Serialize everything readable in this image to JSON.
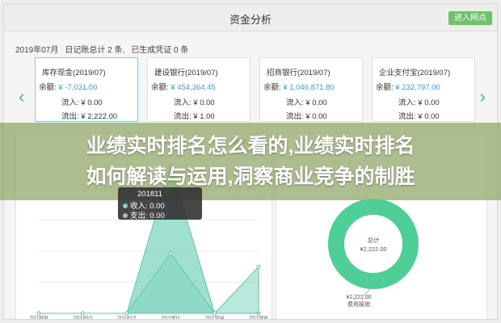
{
  "window": {
    "title": "资金分析",
    "enter_button": "进入网点"
  },
  "summary": {
    "month": "2019年07月",
    "records": "日记账总计 2 条,",
    "generated": "已生成凭证 0 条"
  },
  "accounts": [
    {
      "name": "库存现金(2019/07)",
      "balance_label": "余额: ",
      "balance": "¥ -7,031.00",
      "income": "流入: ¥ 0.00",
      "expense": "流出: ¥ 2,222.00"
    },
    {
      "name": "建设银行(2019/07)",
      "balance_label": "余额: ",
      "balance": "¥ 454,364.45",
      "income": "流入: ¥ 0.00",
      "expense": "流出: ¥ 1.00"
    },
    {
      "name": "招商银行(2019/07)",
      "balance_label": "余额: ",
      "balance": "¥ 1,046,871.80",
      "income": "流入: ¥ 0.00",
      "expense": "流出: ¥ 0.00"
    },
    {
      "name": "企业支付宝(2019/07)",
      "balance_label": "余额: ",
      "balance": "¥ 232,797.00",
      "income": "流入: ¥ 0.00",
      "expense": "流出: ¥ 0.00"
    }
  ],
  "banner": {
    "line1": "业绩实时排名怎么看的,业绩实时排名",
    "line2": "如何解读与运用,洞察商业竞争的制胜"
  },
  "tooltip": {
    "date": "201811",
    "income": "收入: 0.00",
    "expense": "支出: 0.00"
  },
  "legend": {
    "income": "收入",
    "expense": "支出"
  },
  "chart_data": [
    {
      "type": "area",
      "categories": [
        "201808",
        "201810",
        "201812",
        "201902",
        "201904",
        "201906"
      ],
      "series": [
        {
          "name": "收入",
          "values": [
            0,
            0,
            0,
            2222,
            0,
            0
          ]
        },
        {
          "name": "支出",
          "values": [
            0,
            0,
            0,
            900,
            0,
            700
          ]
        }
      ],
      "colors": [
        "#7fd6bf",
        "#7fd6bf"
      ]
    },
    {
      "type": "pie",
      "labels": [
        "费用报销"
      ],
      "values": [
        2222
      ],
      "center_label": "总计",
      "center_value": "¥2,222.00",
      "slice_label": "¥2,222.00",
      "colors": [
        "#4fcf98"
      ]
    }
  ],
  "colors": {
    "accent": "#3a9ad9",
    "button": "#6fc26a",
    "area": "#7fd6bf",
    "donut": "#4fcf98"
  }
}
